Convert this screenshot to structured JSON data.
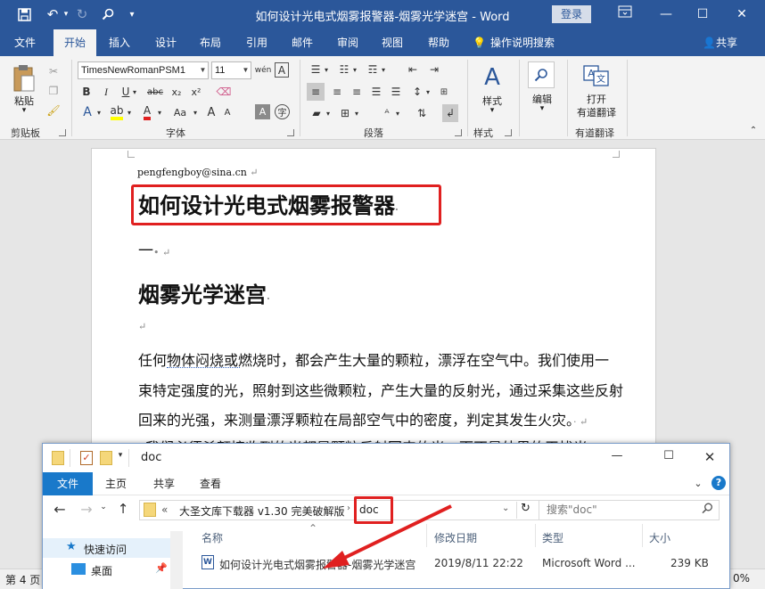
{
  "word": {
    "title": "如何设计光电式烟雾报警器-烟雾光学迷宫 - Word",
    "signin_label": "登录",
    "tabs": [
      "文件",
      "开始",
      "插入",
      "设计",
      "布局",
      "引用",
      "邮件",
      "审阅",
      "视图",
      "帮助"
    ],
    "active_tab": "开始",
    "tellme_label": "操作说明搜索",
    "share_label": "共享",
    "ribbon": {
      "clipboard": {
        "paste_label": "粘贴",
        "group_label": "剪贴板"
      },
      "font": {
        "font_name": "TimesNewRomanPSM1",
        "font_size": "11",
        "group_label": "字体"
      },
      "paragraph": {
        "group_label": "段落"
      },
      "styles": {
        "button_label": "样式",
        "group_label": "样式"
      },
      "editing": {
        "button_label": "编辑"
      },
      "youdao": {
        "button_label_1": "打开",
        "button_label_2": "有道翻译",
        "group_label": "有道翻译"
      }
    },
    "status": {
      "page_label": "第 4 页",
      "zoom_fragment": "0%"
    }
  },
  "document": {
    "email": "pengfengboy@sina.cn",
    "heading": "如何设计光电式烟雾报警器",
    "section_number": "一",
    "subheading": "烟雾光学迷宫",
    "body_lines": [
      "任何物体闷烧或燃烧时，都会产生大量的颗粒，漂浮在空气中。我们使用一",
      "束特定强度的光，照射到这些微颗粒，产生大量的反射光，通过采集这些反射",
      "回来的光强，来测量漂浮颗粒在局部空气中的密度，判定其发生火灾。"
    ],
    "partial_line": "我们必须杀额接收到的光都是颗粒反射回来的光，而不是外界的干扰光"
  },
  "explorer": {
    "title": "doc",
    "tabs": [
      "文件",
      "主页",
      "共享",
      "查看"
    ],
    "breadcrumb": [
      "«",
      "大圣文库下载器 v1.30 完美破解版",
      "doc"
    ],
    "search_placeholder": "搜索\"doc\"",
    "sidebar": [
      "快速访问",
      "桌面"
    ],
    "columns": [
      "名称",
      "修改日期",
      "类型",
      "大小"
    ],
    "files": [
      {
        "name": "如何设计光电式烟雾报警器-烟雾光学迷宫",
        "date": "2019/8/11 22:22",
        "type": "Microsoft Word ...",
        "size": "239 KB"
      }
    ]
  },
  "colors": {
    "word_blue": "#2b579a",
    "highlight_red": "#e02020",
    "explorer_blue": "#1979ca"
  }
}
